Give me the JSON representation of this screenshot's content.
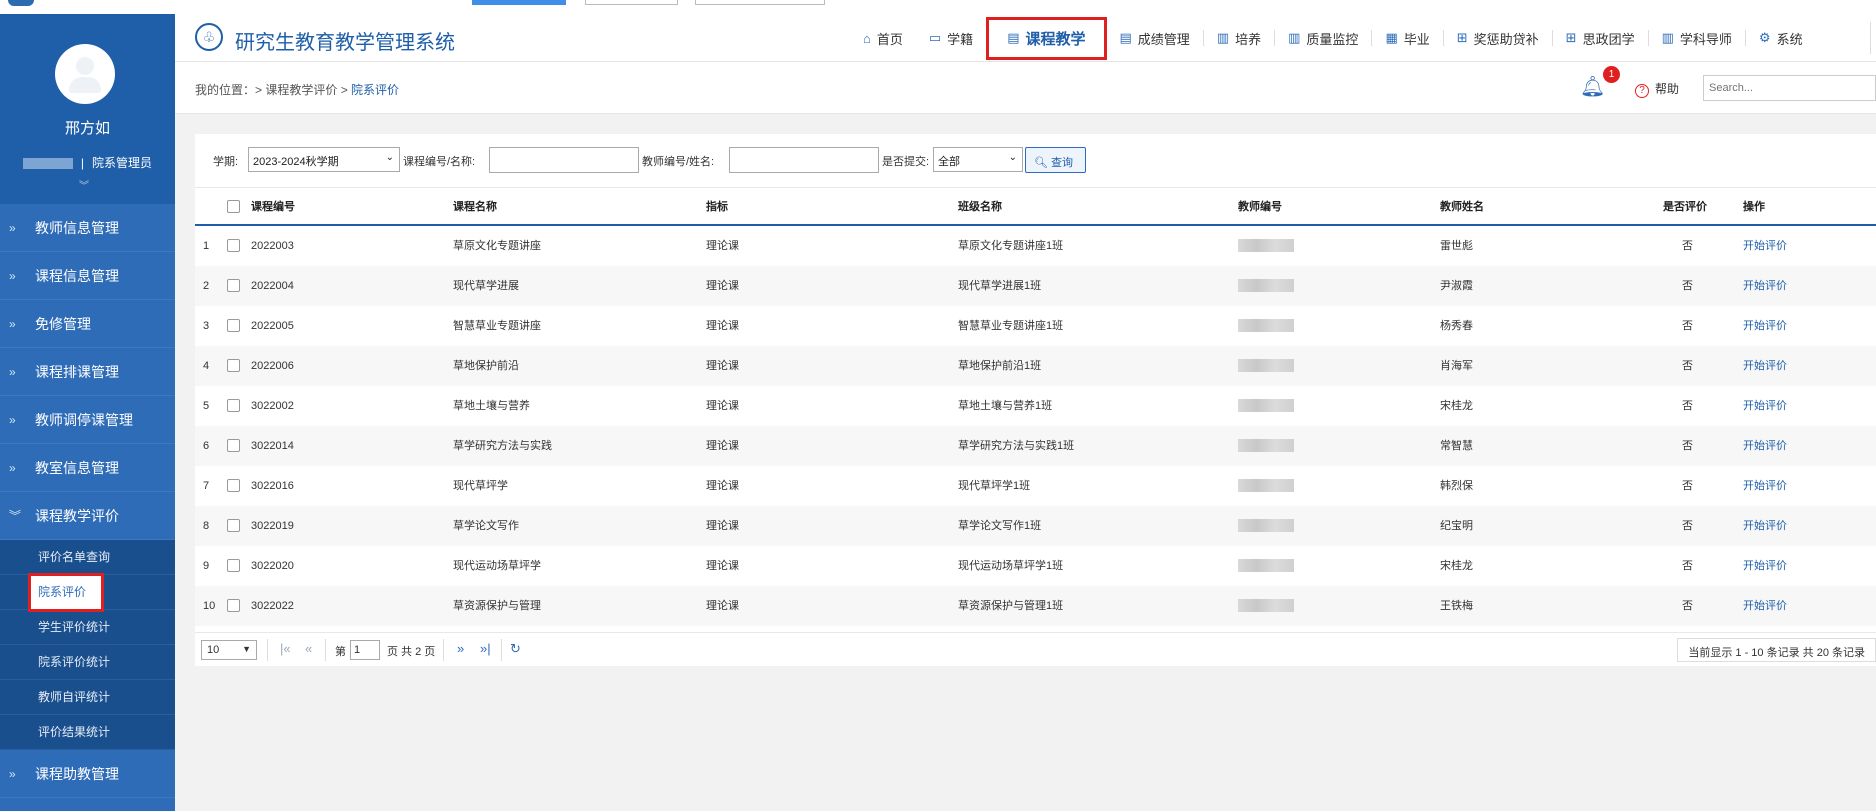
{
  "sidebar": {
    "user_name": "邢方如",
    "user_role": "院系管理员",
    "menu": [
      {
        "label": "教师信息管理"
      },
      {
        "label": "课程信息管理"
      },
      {
        "label": "免修管理"
      },
      {
        "label": "课程排课管理"
      },
      {
        "label": "教师调停课管理"
      },
      {
        "label": "教室信息管理"
      },
      {
        "label": "课程教学评价"
      }
    ],
    "submenu": [
      {
        "label": "评价名单查询"
      },
      {
        "label": "院系评价"
      },
      {
        "label": "学生评价统计"
      },
      {
        "label": "院系评价统计"
      },
      {
        "label": "教师自评统计"
      },
      {
        "label": "评价结果统计"
      }
    ],
    "menu_after": {
      "label": "课程助教管理"
    }
  },
  "header": {
    "system_title": "研究生教育教学管理系统",
    "nav": [
      {
        "label": "首页",
        "icon": "home-icon"
      },
      {
        "label": "学籍",
        "icon": "id-card-icon"
      },
      {
        "label": "课程教学",
        "icon": "document-icon"
      },
      {
        "label": "成绩管理",
        "icon": "document-icon"
      },
      {
        "label": "培养",
        "icon": "book-icon"
      },
      {
        "label": "质量监控",
        "icon": "bar-chart-icon"
      },
      {
        "label": "毕业",
        "icon": "certificate-icon"
      },
      {
        "label": "奖惩助贷补",
        "icon": "grid-icon"
      },
      {
        "label": "思政团学",
        "icon": "grid-icon"
      },
      {
        "label": "学科导师",
        "icon": "bar-chart-icon"
      },
      {
        "label": "系统",
        "icon": "gear-icon"
      }
    ]
  },
  "breadcrumb": {
    "prefix": "我的位置：",
    "path": "> 课程教学评价 > ",
    "current": "院系评价"
  },
  "topbar": {
    "notification_count": "1",
    "help_label": "帮助",
    "search_placeholder": "Search..."
  },
  "filters": {
    "term_label": "学期:",
    "term_value": "2023-2024秋学期",
    "course_label": "课程编号/名称:",
    "teacher_label": "教师编号/姓名:",
    "submitted_label": "是否提交:",
    "submitted_value": "全部",
    "query_button": "查询"
  },
  "table": {
    "headers": [
      "课程编号",
      "课程名称",
      "指标",
      "班级名称",
      "教师编号",
      "教师姓名",
      "是否评价",
      "操作"
    ],
    "rows": [
      {
        "no": "1",
        "code": "2022003",
        "name": "草原文化专题讲座",
        "index": "理论课",
        "class": "草原文化专题讲座1班",
        "teacher": "雷世彪",
        "evaluated": "否",
        "action": "开始评价"
      },
      {
        "no": "2",
        "code": "2022004",
        "name": "现代草学进展",
        "index": "理论课",
        "class": "现代草学进展1班",
        "teacher": "尹淑霞",
        "evaluated": "否",
        "action": "开始评价"
      },
      {
        "no": "3",
        "code": "2022005",
        "name": "智慧草业专题讲座",
        "index": "理论课",
        "class": "智慧草业专题讲座1班",
        "teacher": "杨秀春",
        "evaluated": "否",
        "action": "开始评价"
      },
      {
        "no": "4",
        "code": "2022006",
        "name": "草地保护前沿",
        "index": "理论课",
        "class": "草地保护前沿1班",
        "teacher": "肖海军",
        "evaluated": "否",
        "action": "开始评价"
      },
      {
        "no": "5",
        "code": "3022002",
        "name": "草地土壤与营养",
        "index": "理论课",
        "class": "草地土壤与营养1班",
        "teacher": "宋桂龙",
        "evaluated": "否",
        "action": "开始评价"
      },
      {
        "no": "6",
        "code": "3022014",
        "name": "草学研究方法与实践",
        "index": "理论课",
        "class": "草学研究方法与实践1班",
        "teacher": "常智慧",
        "evaluated": "否",
        "action": "开始评价"
      },
      {
        "no": "7",
        "code": "3022016",
        "name": "现代草坪学",
        "index": "理论课",
        "class": "现代草坪学1班",
        "teacher": "韩烈保",
        "evaluated": "否",
        "action": "开始评价"
      },
      {
        "no": "8",
        "code": "3022019",
        "name": "草学论文写作",
        "index": "理论课",
        "class": "草学论文写作1班",
        "teacher": "纪宝明",
        "evaluated": "否",
        "action": "开始评价"
      },
      {
        "no": "9",
        "code": "3022020",
        "name": "现代运动场草坪学",
        "index": "理论课",
        "class": "现代运动场草坪学1班",
        "teacher": "宋桂龙",
        "evaluated": "否",
        "action": "开始评价"
      },
      {
        "no": "10",
        "code": "3022022",
        "name": "草资源保护与管理",
        "index": "理论课",
        "class": "草资源保护与管理1班",
        "teacher": "王铁梅",
        "evaluated": "否",
        "action": "开始评价"
      }
    ]
  },
  "pager": {
    "page_size": "10",
    "page_prefix": "第",
    "page_value": "1",
    "page_suffix": "页 共 2 页",
    "info": "当前显示 1 - 10 条记录 共 20 条记录"
  },
  "colors": {
    "primary": "#2e6cb8",
    "sidebar_dark": "#1f5ea8",
    "highlight_border": "#e02020"
  }
}
